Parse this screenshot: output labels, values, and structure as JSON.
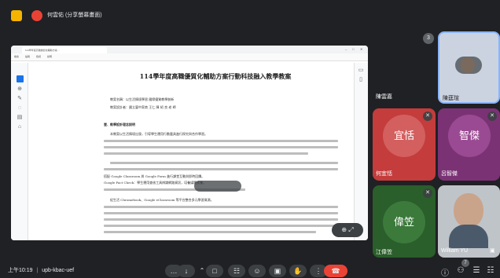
{
  "presenter": {
    "label": "何雲佑 (分享螢幕畫面)"
  },
  "shared_window": {
    "tab_label": "114學年度高職優質化輔助方案…",
    "menu": [
      "檔案",
      "編輯",
      "檢視",
      "說明"
    ],
    "document": {
      "title": "114學年度高職優質化輔助方案行動科技融入教學教案",
      "meta": [
        "教案名稱：以生活情境學習  國際優質教學創新",
        "教案設計者：國立臺中家商 王仁  陳 紹 良 老 師"
      ],
      "section_heading": "壹、教學設計理念說明",
      "paragraphs": [
        "本教案以生活情境出發，引導學生運用行動載具進行探究與合作學習。",
        "搭配 Google Classroom 與 Google Form 進行課堂互動與即時回饋。",
        "Google Fact Check：學生運用查核工具辨識網路資訊，培養媒體素養。",
        "從生活 Chromebook、Google eClassroom 等平台整合多元學習資源。"
      ]
    }
  },
  "participants": [
    {
      "name": "陳雲嘉",
      "muted": true,
      "type": "dark"
    },
    {
      "name": "陳莛瑄",
      "muted": false,
      "type": "self-video"
    },
    {
      "name": "何宜恬",
      "initials": "宜恬",
      "color": "#c64a4a",
      "muted": true
    },
    {
      "name": "呂智傑",
      "initials": "智傑",
      "color": "#8e3a80",
      "muted": true
    },
    {
      "name": "江偉笠",
      "initials": "偉笠",
      "color": "#2e6b2e",
      "muted": true
    },
    {
      "name": "William YU",
      "muted": false,
      "type": "video"
    }
  ],
  "others_badge": "3",
  "bottom": {
    "time": "上午10:19",
    "separator": "|",
    "meeting_code": "upb-kbac-uef",
    "controls": [
      "more-options",
      "mic",
      "camera",
      "captions",
      "emoji",
      "present",
      "raise-hand",
      "more",
      "hangup"
    ],
    "participants_count": "7"
  },
  "colors": {
    "background": "#202124",
    "hangup": "#ea4335",
    "accent": "#1a73e8"
  },
  "icons": {
    "mic": "↓",
    "cam": "□",
    "cc": "☷",
    "emoji": "☺",
    "present": "▣",
    "hand": "✋",
    "more": "⋮",
    "hangup": "☎",
    "info": "ⓘ",
    "people": "⚇",
    "chat": "☰",
    "activities": "☷",
    "mute": "✕",
    "expand": "⤢",
    "zoom": "⊕"
  }
}
